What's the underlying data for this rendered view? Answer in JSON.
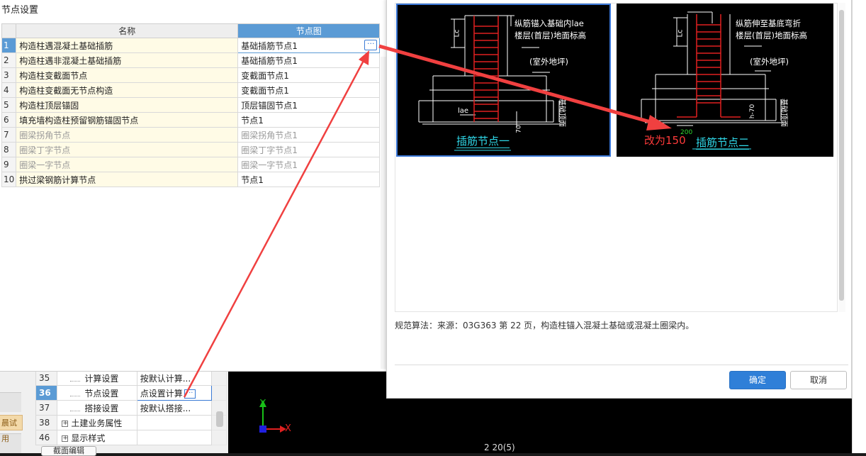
{
  "left_dialog": {
    "title": "节点设置",
    "headers": {
      "name": "名称",
      "node": "节点图"
    },
    "rows": [
      {
        "num": "1",
        "name": "构造柱遇混凝土基础插筋",
        "node": "基础插筋节点1"
      },
      {
        "num": "2",
        "name": "构造柱遇非混凝土基础插筋",
        "node": "基础插筋节点1"
      },
      {
        "num": "3",
        "name": "构造柱变截面节点",
        "node": "变截面节点1"
      },
      {
        "num": "4",
        "name": "构造柱变截面无节点构造",
        "node": "变截面节点1"
      },
      {
        "num": "5",
        "name": "构造柱顶层锚固",
        "node": "顶层锚固节点1"
      },
      {
        "num": "6",
        "name": "填充墙构造柱预留钢筋锚固节点",
        "node": "节点1"
      },
      {
        "num": "7",
        "name": "圈梁拐角节点",
        "node": "圈梁拐角节点1"
      },
      {
        "num": "8",
        "name": "圈梁丁字节点",
        "node": "圈梁丁字节点1"
      },
      {
        "num": "9",
        "name": "圈梁一字节点",
        "node": "圈梁一字节点1"
      },
      {
        "num": "10",
        "name": "拱过梁钢筋计算节点",
        "node": "节点1"
      }
    ],
    "ellipsis": "···"
  },
  "right_dialog": {
    "node1": {
      "caption": "插筋节点一",
      "label_line1": "纵筋锚入基础内lae",
      "label_line2": "楼层(首层)地面标高",
      "label_outdoor": "(室外地坪)",
      "lae": "lae",
      "lc": "Lc",
      "dim70": "70",
      "side": "基础顶面"
    },
    "node2": {
      "caption": "插筋节点二",
      "label_line1": "纵筋伸至基底弯折",
      "label_line2": "楼层(首层)地面标高",
      "label_outdoor": "(室外地坪)",
      "lc": "Lc",
      "dim200": "200",
      "dim_h": "h-70",
      "side": "基础顶面",
      "annotation": "改为150"
    },
    "rule_text": "规范算法：来源：03G363 第 22 页，构造柱锚入混凝土基础或混凝土圈梁内。",
    "ok_label": "确定",
    "cancel_label": "取消"
  },
  "background": {
    "rows": [
      {
        "num": "35",
        "name": "计算设置",
        "value": "按默认计算..."
      },
      {
        "num": "36",
        "name": "节点设置",
        "value": "点设置计算"
      },
      {
        "num": "37",
        "name": "搭接设置",
        "value": "按默认搭接..."
      },
      {
        "num": "38",
        "name": "土建业务属性",
        "value": ""
      },
      {
        "num": "46",
        "name": "显示样式",
        "value": ""
      }
    ],
    "expand_glyph": "+",
    "trial_badge": "晨试用",
    "bottom_button": "截面编辑",
    "axis_x": "X",
    "axis_y": "Y",
    "canvas_text": "2 20(5)"
  },
  "colors": {
    "accent": "#2f7fd8",
    "selection": "#5b9bd5",
    "annotation": "#ff3a3a",
    "caption": "#2fd8e8"
  }
}
